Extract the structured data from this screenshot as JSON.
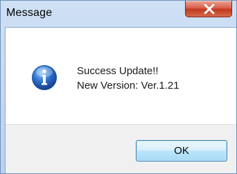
{
  "window": {
    "title": "Message"
  },
  "message": {
    "line1": "Success Update!!",
    "line2": "New Version: Ver.1.21"
  },
  "buttons": {
    "ok_label": "OK"
  },
  "icons": {
    "message_icon": "information-icon",
    "close_icon": "close-icon"
  },
  "colors": {
    "titlebar": "#c4d9f1",
    "close_button": "#c8432b",
    "info_icon": "#2b6fc9",
    "ok_button_border": "#3c7fb1"
  }
}
